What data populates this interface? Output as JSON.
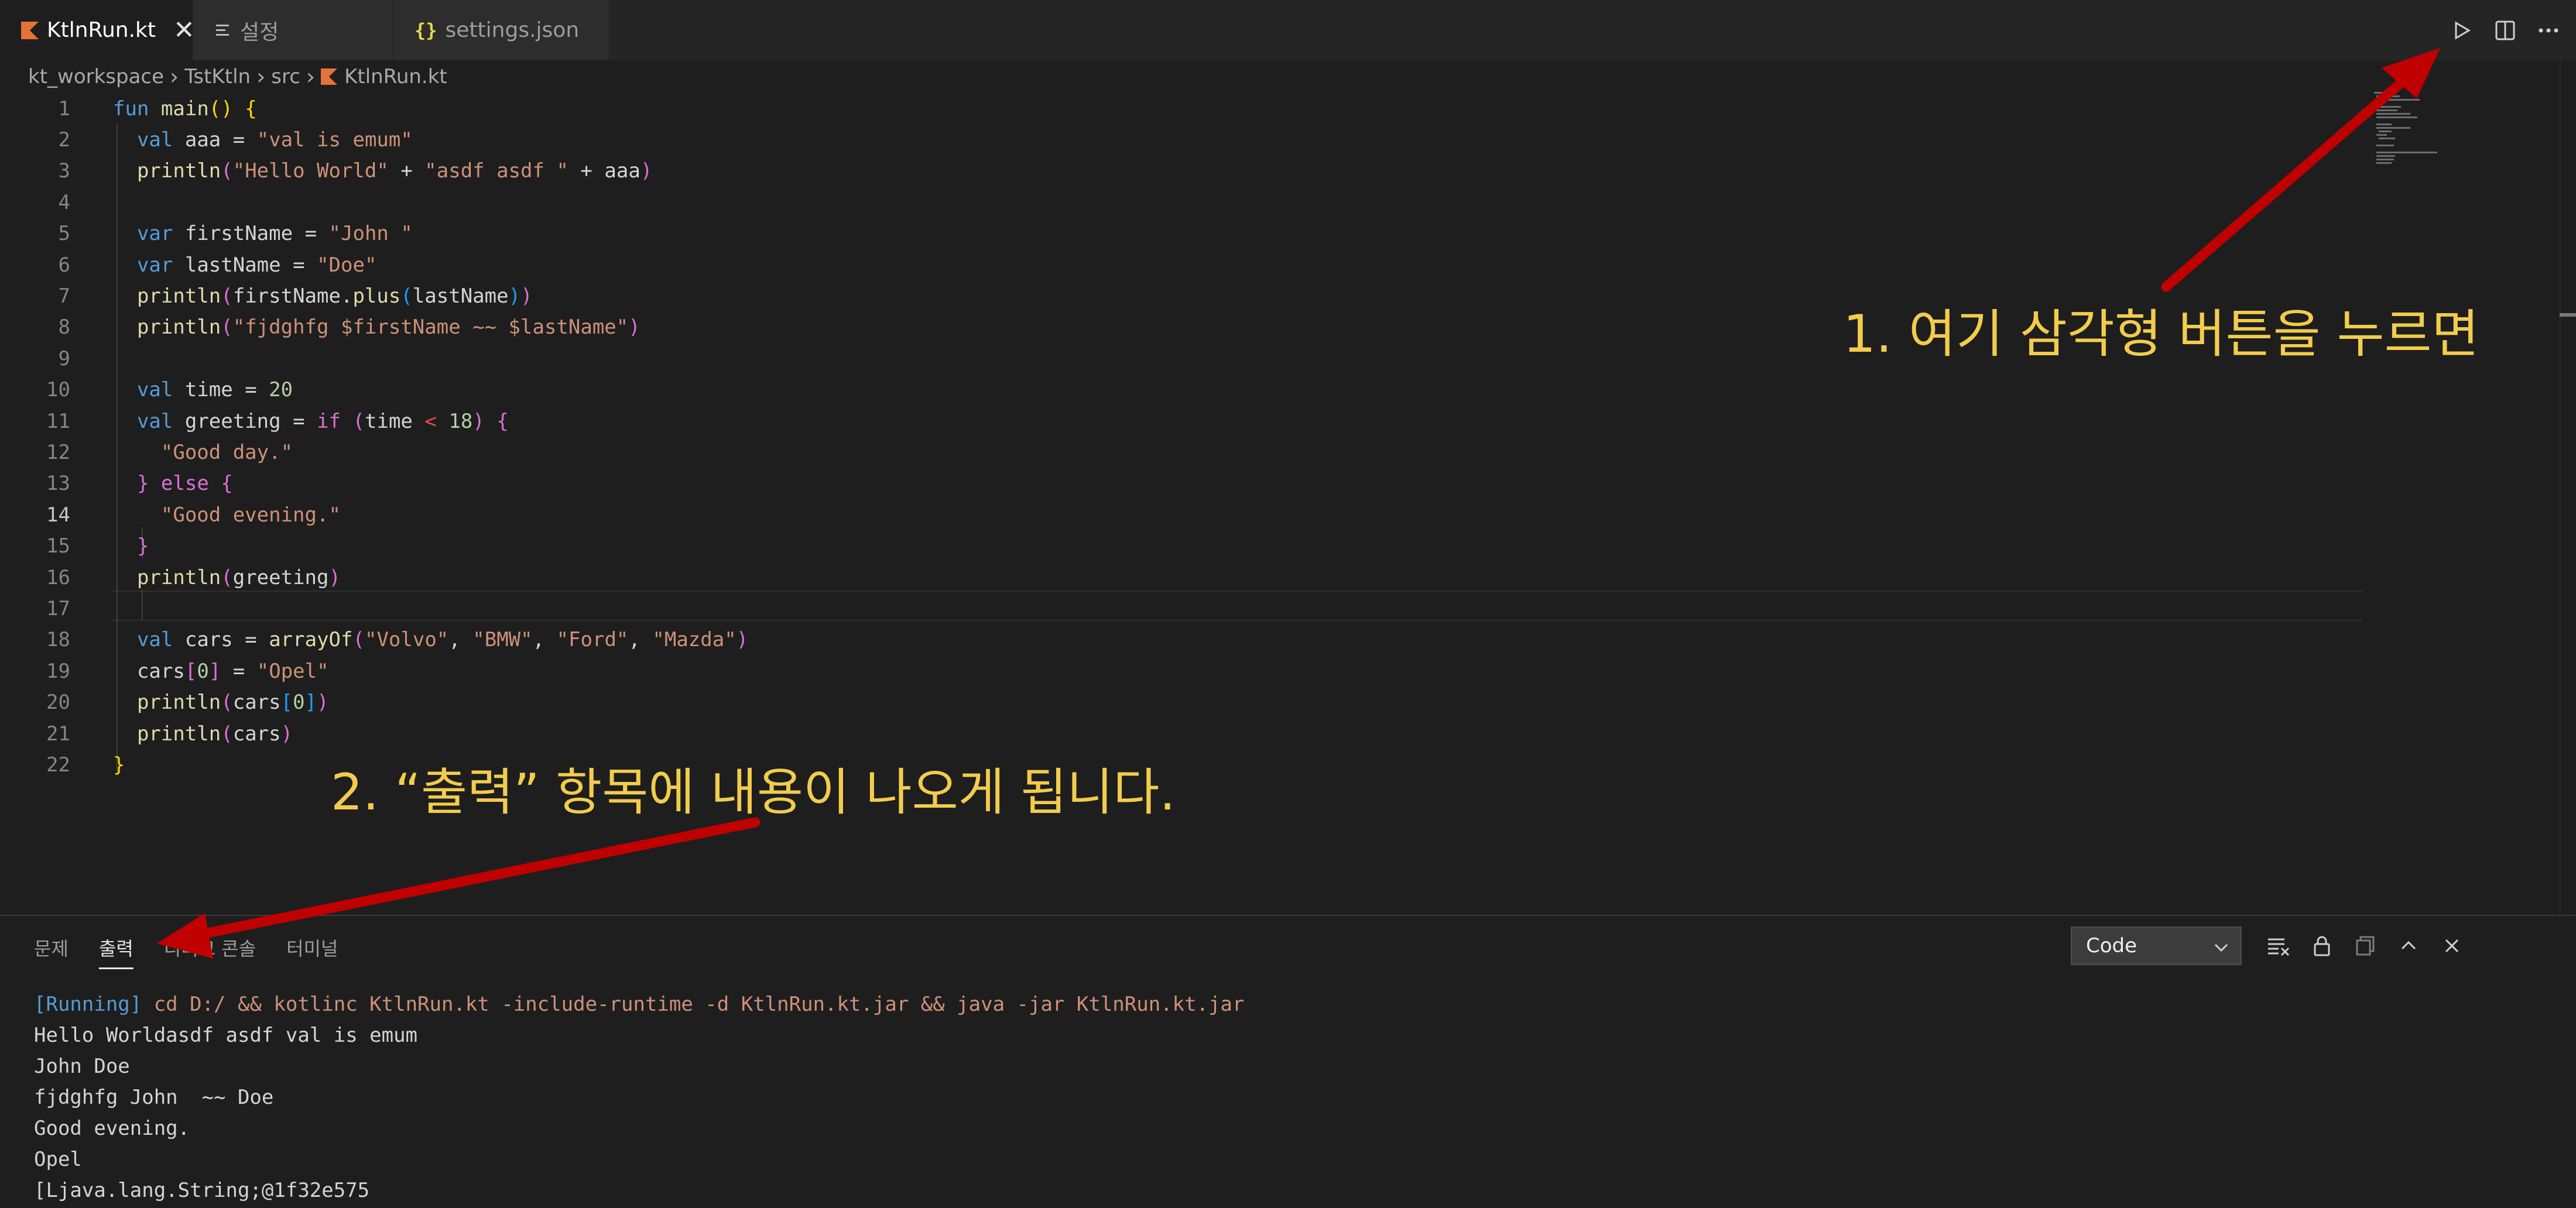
{
  "tabs": [
    {
      "label": "KtlnRun.kt",
      "icon": "kotlin-icon",
      "active": true
    },
    {
      "label": "설정",
      "icon": "settings-doc-icon",
      "active": false
    },
    {
      "label": "settings.json",
      "icon": "json-braces-icon",
      "active": false
    }
  ],
  "breadcrumb": [
    "kt_workspace",
    "TstKtln",
    "src",
    "KtlnRun.kt"
  ],
  "editor_actions": [
    "run-triangle-icon",
    "split-editor-icon",
    "more-icon"
  ],
  "code_lines": [
    "fun main() {",
    "  val aaa = \"val is emum\"",
    "  println(\"Hello World\" + \"asdf asdf \" + aaa)",
    "",
    "  var firstName = \"John \"",
    "  var lastName = \"Doe\"",
    "  println(firstName.plus(lastName))",
    "  println(\"fjdghfg $firstName ~~ $lastName\")",
    "",
    "  val time = 20",
    "  val greeting = if (time < 18) {",
    "    \"Good day.\"",
    "  } else {",
    "    \"Good evening.\"",
    "  }",
    "  println(greeting)",
    "",
    "  val cars = arrayOf(\"Volvo\", \"BMW\", \"Ford\", \"Mazda\")",
    "  cars[0] = \"Opel\"",
    "  println(cars[0])",
    "  println(cars)",
    "}"
  ],
  "current_line": 14,
  "panel": {
    "tabs": [
      "문제",
      "출력",
      "디버그 콘솔",
      "터미널"
    ],
    "active_tab": "출력",
    "channel_select": "Code",
    "tools": [
      "clear-output-icon",
      "lock-icon",
      "copy-icon",
      "maximize-chevron-icon",
      "close-icon"
    ],
    "output": {
      "running_tag": "[Running]",
      "command": " cd D:/ && kotlinc KtlnRun.kt -include-runtime -d KtlnRun.kt.jar && java -jar KtlnRun.kt.jar",
      "lines": [
        "Hello Worldasdf asdf val is emum",
        "John Doe",
        "fjdghfg John  ~~ Doe",
        "Good evening.",
        "Opel",
        "[Ljava.lang.String;@1f32e575"
      ]
    }
  },
  "annotations": {
    "step1": "1. 여기 삼각형 버튼을 누르면",
    "step2": "2. “출력” 항목에 내용이 나오게 됩니다.",
    "arrow_color": "#c00000",
    "text_color": "#f2cc4c"
  }
}
